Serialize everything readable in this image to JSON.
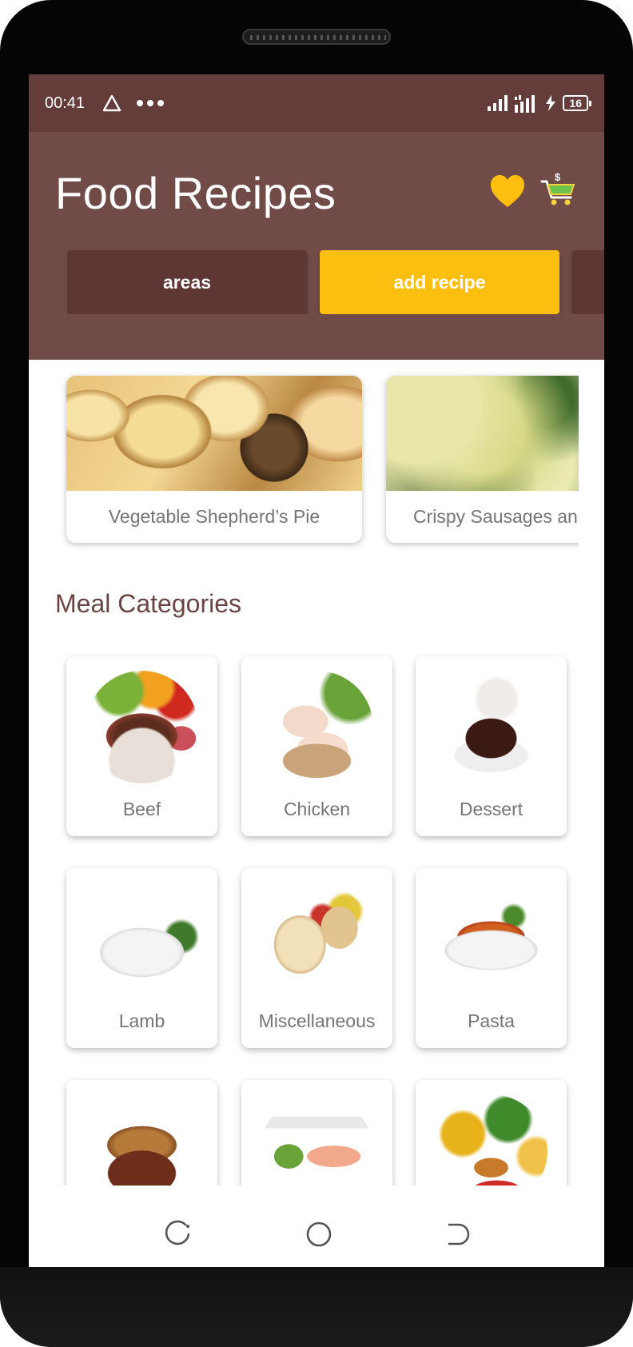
{
  "status_bar": {
    "time": "00:41",
    "battery": "16"
  },
  "app": {
    "title": "Food Recipes",
    "favorite_icon": "heart-icon",
    "cart_icon": "shopping-cart-icon"
  },
  "tabs": [
    {
      "label": "areas"
    },
    {
      "label": "add recipe"
    },
    {
      "label": ""
    }
  ],
  "featured_recipes": [
    {
      "name": "Vegetable Shepherd’s Pie"
    },
    {
      "name": "Crispy Sausages and Greens"
    }
  ],
  "section": {
    "title": "Meal Categories"
  },
  "categories": [
    {
      "name": "Beef"
    },
    {
      "name": "Chicken"
    },
    {
      "name": "Dessert"
    },
    {
      "name": "Lamb"
    },
    {
      "name": "Miscellaneous"
    },
    {
      "name": "Pasta"
    },
    {
      "name": ""
    },
    {
      "name": ""
    },
    {
      "name": ""
    }
  ],
  "colors": {
    "status_bar": "#643c3a",
    "header": "#714b48",
    "tab_dark": "#5e3634",
    "accent": "#fdbf0f"
  }
}
